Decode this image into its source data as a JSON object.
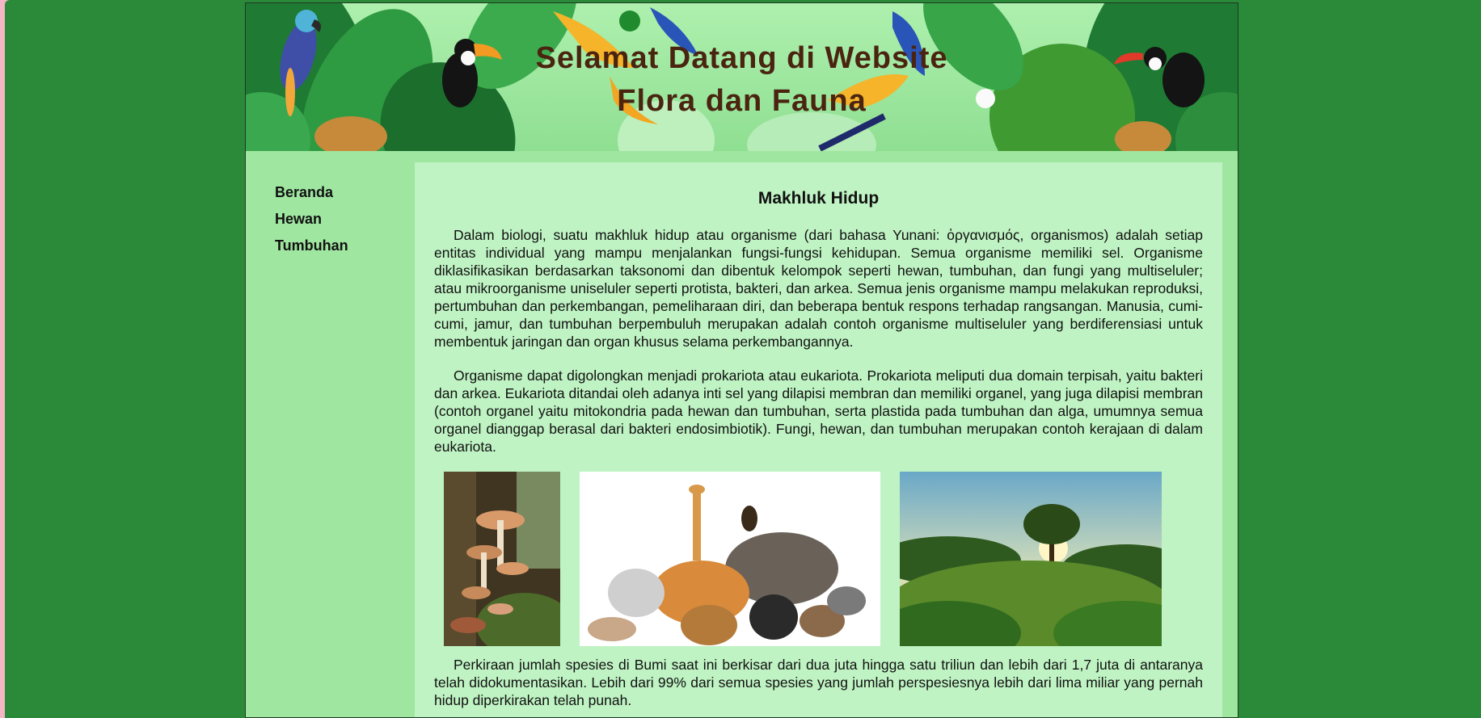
{
  "header": {
    "title_line1": "Selamat Datang di Website",
    "title_line2": "Flora dan Fauna"
  },
  "sidebar": {
    "items": [
      {
        "label": "Beranda"
      },
      {
        "label": "Hewan"
      },
      {
        "label": "Tumbuhan"
      }
    ]
  },
  "main": {
    "title": "Makhluk Hidup",
    "paragraphs": [
      "Dalam biologi, suatu makhluk hidup atau organisme (dari bahasa Yunani: ὀργανισμός, organismos) adalah setiap entitas individual yang mampu menjalankan fungsi-fungsi kehidupan. Semua organisme memiliki sel. Organisme diklasifikasikan berdasarkan taksonomi dan dibentuk kelompok seperti hewan, tumbuhan, dan fungi yang multiseluler; atau mikroorganisme uniseluler seperti protista, bakteri, dan arkea. Semua jenis organisme mampu melakukan reproduksi, pertumbuhan dan perkembangan, pemeliharaan diri, dan beberapa bentuk respons terhadap rangsangan. Manusia, cumi-cumi, jamur, dan tumbuhan berpembuluh merupakan adalah contoh organisme multiseluler yang berdiferensiasi untuk membentuk jaringan dan organ khusus selama perkembangannya.",
      "Organisme dapat digolongkan menjadi prokariota atau eukariota. Prokariota meliputi dua domain terpisah, yaitu bakteri dan arkea. Eukariota ditandai oleh adanya inti sel yang dilapisi membran dan memiliki organel, yang juga dilapisi membran (contoh organel yaitu mitokondria pada hewan dan tumbuhan, serta plastida pada tumbuhan dan alga, umumnya semua organel dianggap berasal dari bakteri endosimbiotik). Fungi, hewan, dan tumbuhan merupakan contoh kerajaan di dalam eukariota."
    ],
    "paragraph3": "Perkiraan jumlah spesies di Bumi saat ini berkisar dari dua juta hingga satu triliun dan lebih dari 1,7 juta di antaranya telah didokumentasikan. Lebih dari 99% dari semua spesies yang jumlah perspesiesnya lebih dari lima miliar yang pernah hidup diperkirakan telah punah."
  },
  "colors": {
    "page_bg": "#2a8a3a",
    "container_bg": "#9fe6a0",
    "content_bg": "#bff3c3",
    "title_color": "#4a2410"
  },
  "icons": [
    "macaw-image",
    "toucan-image",
    "jungle-leaves-image",
    "mushroom-photo",
    "animals-group-photo",
    "forest-sunrise-photo"
  ]
}
